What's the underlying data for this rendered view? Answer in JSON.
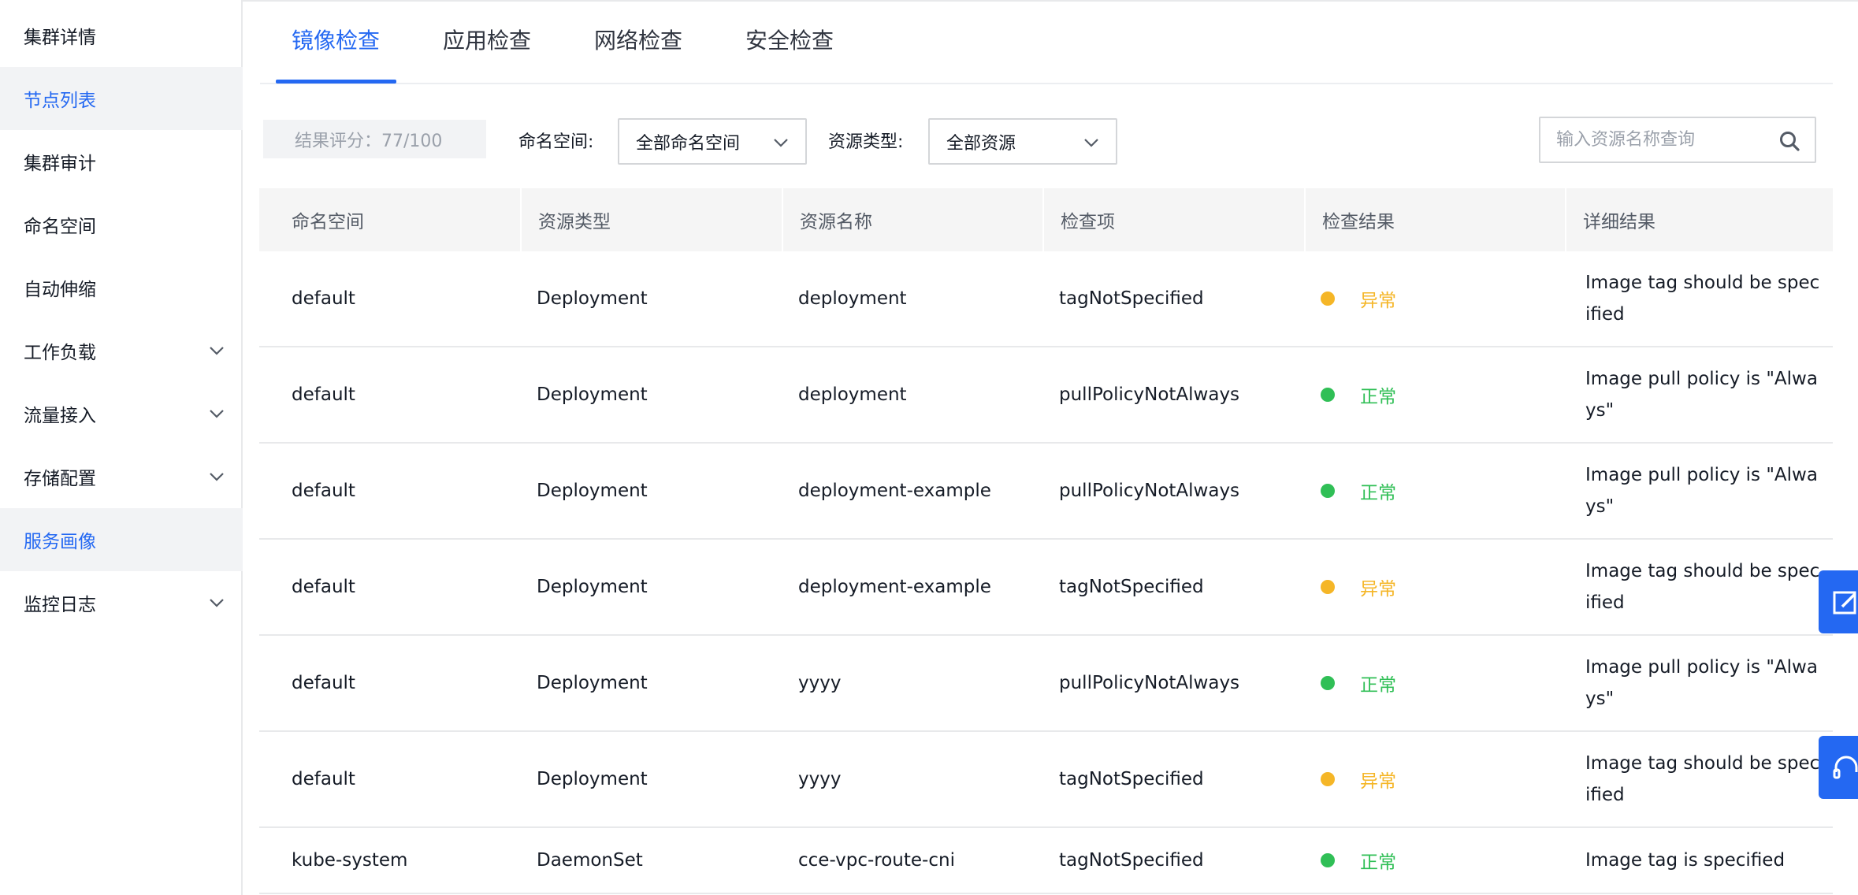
{
  "sidebar": {
    "items": [
      {
        "label": "集群详情",
        "active": false,
        "expandable": false
      },
      {
        "label": "节点列表",
        "active": true,
        "expandable": false
      },
      {
        "label": "集群审计",
        "active": false,
        "expandable": false
      },
      {
        "label": "命名空间",
        "active": false,
        "expandable": false
      },
      {
        "label": "自动伸缩",
        "active": false,
        "expandable": false
      },
      {
        "label": "工作负载",
        "active": false,
        "expandable": true
      },
      {
        "label": "流量接入",
        "active": false,
        "expandable": true
      },
      {
        "label": "存储配置",
        "active": false,
        "expandable": true
      },
      {
        "label": "服务画像",
        "active": true,
        "expandable": false
      },
      {
        "label": "监控日志",
        "active": false,
        "expandable": true
      }
    ]
  },
  "tabs": [
    {
      "label": "镜像检查",
      "active": true
    },
    {
      "label": "应用检查",
      "active": false
    },
    {
      "label": "网络检查",
      "active": false
    },
    {
      "label": "安全检查",
      "active": false
    }
  ],
  "filters": {
    "score": "结果评分：77/100",
    "namespace_label": "命名空间:",
    "namespace_value": "全部命名空间",
    "resource_type_label": "资源类型:",
    "resource_type_value": "全部资源",
    "search_placeholder": "输入资源名称查询"
  },
  "table": {
    "columns": [
      "命名空间",
      "资源类型",
      "资源名称",
      "检查项",
      "检查结果",
      "详细结果"
    ],
    "rows": [
      {
        "namespace": "default",
        "type": "Deployment",
        "name": "deployment",
        "check": "tagNotSpecified",
        "result": "异常",
        "status": "warning",
        "detail": "Image tag should be specified"
      },
      {
        "namespace": "default",
        "type": "Deployment",
        "name": "deployment",
        "check": "pullPolicyNotAlways",
        "result": "正常",
        "status": "ok",
        "detail": "Image pull policy is \"Always\""
      },
      {
        "namespace": "default",
        "type": "Deployment",
        "name": "deployment-example",
        "check": "pullPolicyNotAlways",
        "result": "正常",
        "status": "ok",
        "detail": "Image pull policy is \"Always\""
      },
      {
        "namespace": "default",
        "type": "Deployment",
        "name": "deployment-example",
        "check": "tagNotSpecified",
        "result": "异常",
        "status": "warning",
        "detail": "Image tag should be specified"
      },
      {
        "namespace": "default",
        "type": "Deployment",
        "name": "yyyy",
        "check": "pullPolicyNotAlways",
        "result": "正常",
        "status": "ok",
        "detail": "Image pull policy is \"Always\""
      },
      {
        "namespace": "default",
        "type": "Deployment",
        "name": "yyyy",
        "check": "tagNotSpecified",
        "result": "异常",
        "status": "warning",
        "detail": "Image tag should be specified"
      },
      {
        "namespace": "kube-system",
        "type": "DaemonSet",
        "name": "cce-vpc-route-cni",
        "check": "tagNotSpecified",
        "result": "正常",
        "status": "ok",
        "detail": "Image tag is specified"
      }
    ]
  },
  "floating_tools": [
    {
      "icon": "edit-icon"
    },
    {
      "icon": "headset-icon"
    }
  ],
  "colors": {
    "accent": "#2468f2",
    "warning": "#f5b627",
    "ok": "#30bf56"
  }
}
